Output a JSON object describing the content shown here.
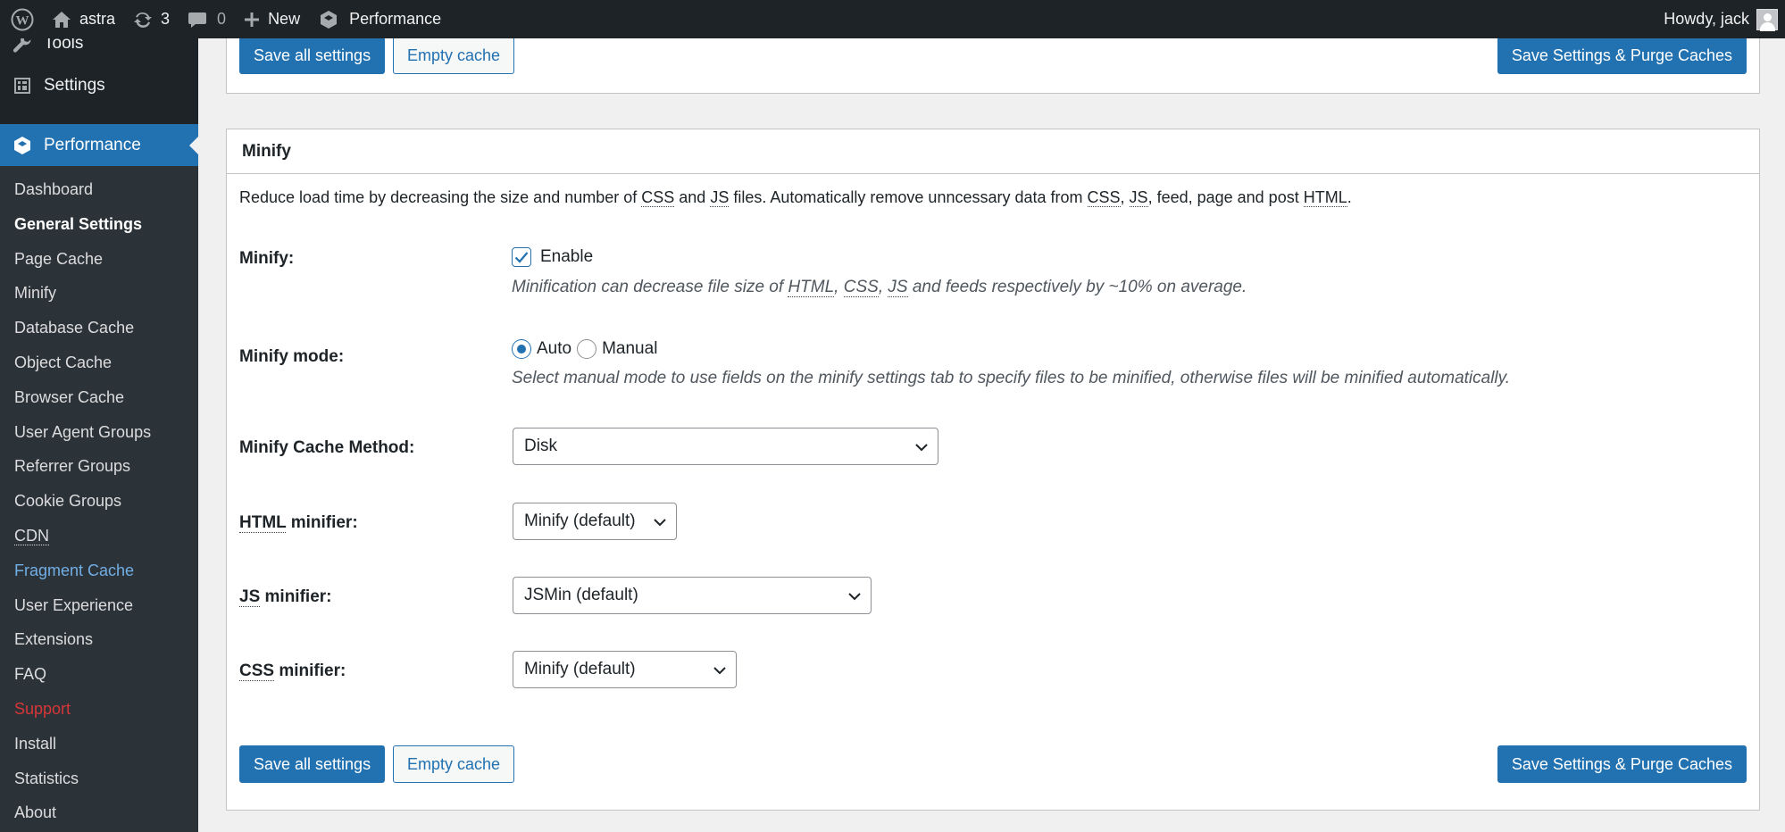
{
  "adminbar": {
    "site_name": "astra",
    "updates_count": "3",
    "comments_count": "0",
    "new_label": "New",
    "performance_label": "Performance",
    "howdy": "Howdy, jack"
  },
  "sidebar": {
    "tools_label": "Tools",
    "settings_label": "Settings",
    "performance_label": "Performance",
    "submenu": [
      "Dashboard",
      "General Settings",
      "Page Cache",
      "Minify",
      "Database Cache",
      "Object Cache",
      "Browser Cache",
      "User Agent Groups",
      "Referrer Groups",
      "Cookie Groups",
      "CDN",
      "Fragment Cache",
      "User Experience",
      "Extensions",
      "FAQ",
      "Support",
      "Install",
      "Statistics",
      "About"
    ]
  },
  "buttons": {
    "save_all": "Save all settings",
    "empty_cache": "Empty cache",
    "save_purge": "Save Settings & Purge Caches"
  },
  "minify": {
    "title": "Minify",
    "description_parts": [
      "Reduce load time by decreasing the size and number of ",
      "CSS",
      " and ",
      "JS",
      " files. Automatically remove unncessary data from ",
      "CSS",
      ", ",
      "JS",
      ", feed, page and post ",
      "HTML",
      "."
    ],
    "minify_label": "Minify:",
    "enable_label": "Enable",
    "enable_checked": true,
    "minify_hint_parts": [
      "Minification can decrease file size of ",
      "HTML",
      ", ",
      "CSS",
      ", ",
      "JS",
      " and feeds respectively by ~10% on average."
    ],
    "mode_label": "Minify mode:",
    "mode_auto": "Auto",
    "mode_manual": "Manual",
    "mode_selected": "Auto",
    "mode_hint": "Select manual mode to use fields on the minify settings tab to specify files to be minified, otherwise files will be minified automatically.",
    "cache_method_label": "Minify Cache Method:",
    "cache_method_value": "Disk",
    "html_minifier_abbr": "HTML",
    "html_minifier_suffix": " minifier:",
    "html_minifier_value": "Minify (default)",
    "js_minifier_abbr": "JS",
    "js_minifier_suffix": " minifier:",
    "js_minifier_value": "JSMin (default)",
    "css_minifier_abbr": "CSS",
    "css_minifier_suffix": " minifier:",
    "css_minifier_value": "Minify (default)"
  },
  "colors": {
    "primary": "#2271b1",
    "admin_bar": "#1d2327",
    "fragment_cache_link": "#72aee6",
    "support_link": "#d63638"
  }
}
